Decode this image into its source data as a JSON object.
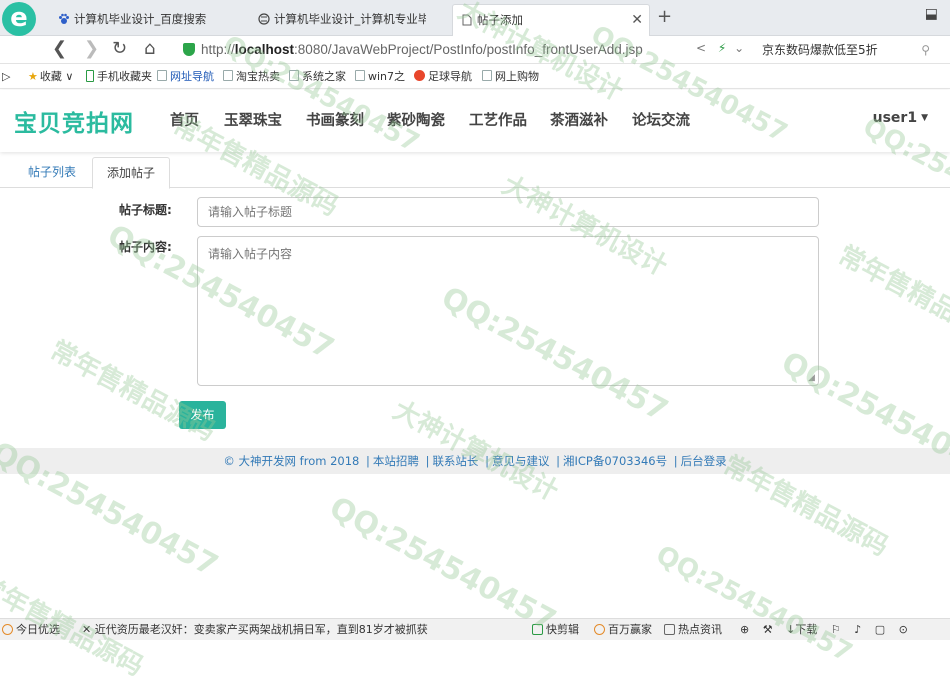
{
  "browser": {
    "tabs": [
      {
        "label": "计算机毕业设计_百度搜索",
        "icon": "baidu-paw-icon"
      },
      {
        "label": "计算机毕业设计_计算机专业毕",
        "icon": "globe-icon"
      },
      {
        "label": "帖子添加",
        "icon": "page-icon"
      }
    ],
    "url_prefix": "http://",
    "url_host": "localhost",
    "url_rest": ":8080/JavaWebProject/PostInfo/postInfo_frontUserAdd.jsp",
    "search_text": "京东数码爆款低至5折",
    "bookmarks": [
      "收藏",
      "手机收藏夹",
      "网址导航",
      "淘宝热卖",
      "系统之家",
      "win7之",
      "足球导航",
      "网上购物"
    ]
  },
  "site": {
    "brand": "宝贝竞拍网",
    "nav": [
      "首页",
      "玉翠珠宝",
      "书画篆刻",
      "紫砂陶瓷",
      "工艺作品",
      "茶酒滋补",
      "论坛交流"
    ],
    "user": "user1",
    "brand_color": "#2bbb9f"
  },
  "content_tabs": {
    "list": "帖子列表",
    "add": "添加帖子"
  },
  "form": {
    "title_label": "帖子标题:",
    "title_placeholder": "请输入帖子标题",
    "content_label": "帖子内容:",
    "content_placeholder": "请输入帖子内容",
    "submit_label": "发布",
    "submit_color": "#2ab39c"
  },
  "footer": {
    "copyright": "© 大神开发网 from 2018",
    "links": [
      "本站招聘",
      "联系站长",
      "意见与建议",
      "湘ICP备0703346号",
      "后台登录"
    ]
  },
  "statusbar": {
    "today": "今日优选",
    "news": "近代资历最老汉奸：变卖家产买两架战机捐日军，直到81岁才被抓获",
    "tools": [
      "快剪辑",
      "百万赢家",
      "热点资讯",
      "下载"
    ]
  },
  "watermark": {
    "qq": "QQ:254540457",
    "text1": "大神计算机设计",
    "text2": "常年售精品源码"
  }
}
